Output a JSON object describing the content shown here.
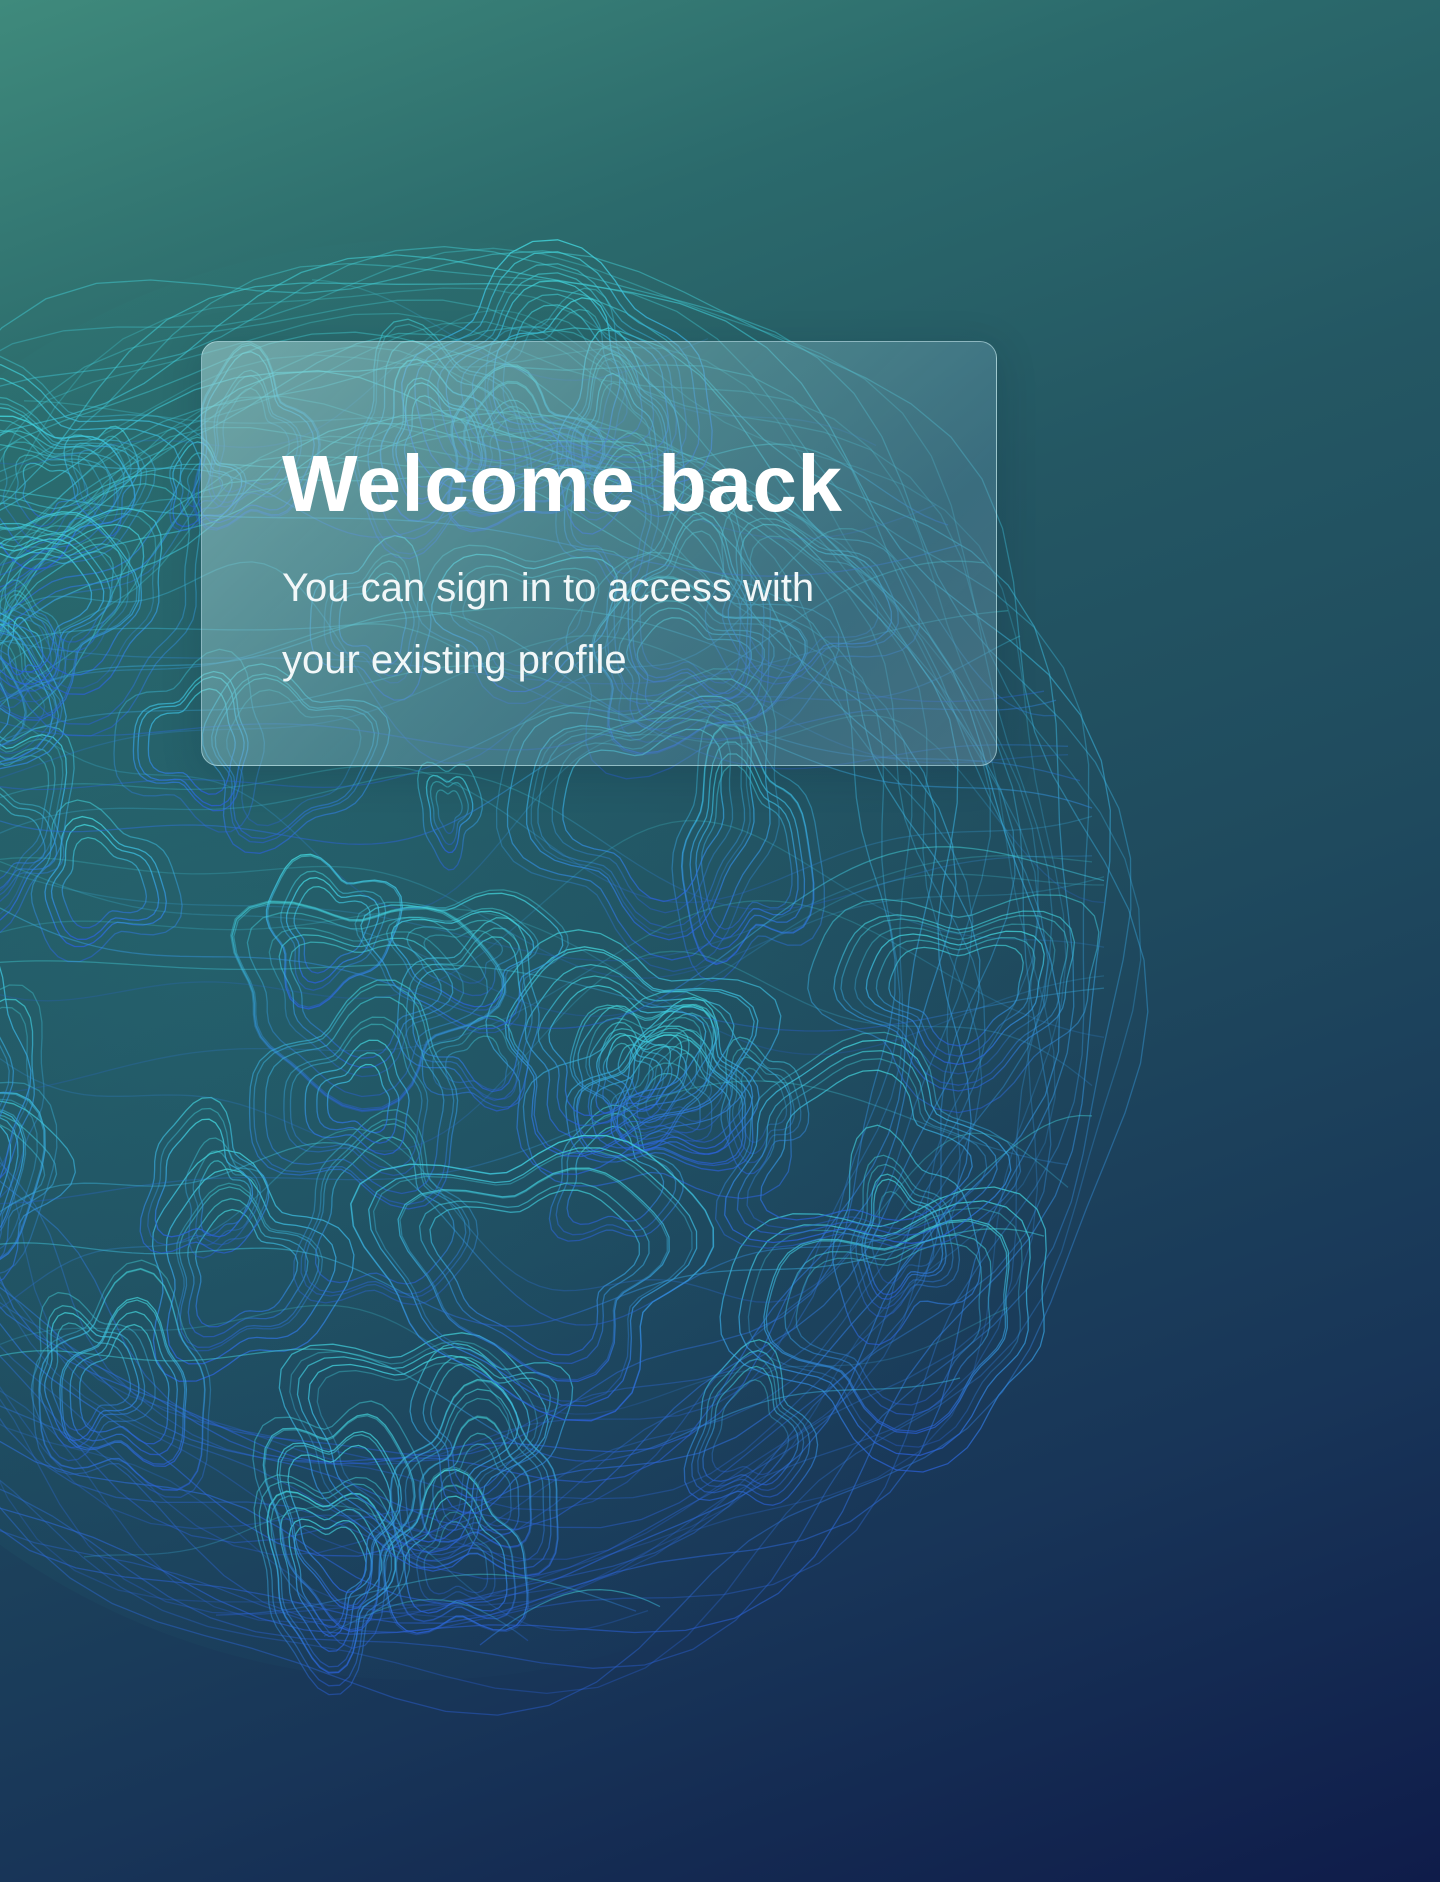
{
  "card": {
    "title": "Welcome back",
    "subtitle": "You can sign in to access with your existing profile"
  },
  "colors": {
    "background_top": "#3f8a7c",
    "background_bottom": "#0f1c4a",
    "contour_cyan": "#3fd2dc",
    "contour_blue": "#2f6ee0",
    "card_text": "#ffffff"
  },
  "icons": {
    "background": "topographic-sphere-illustration"
  }
}
